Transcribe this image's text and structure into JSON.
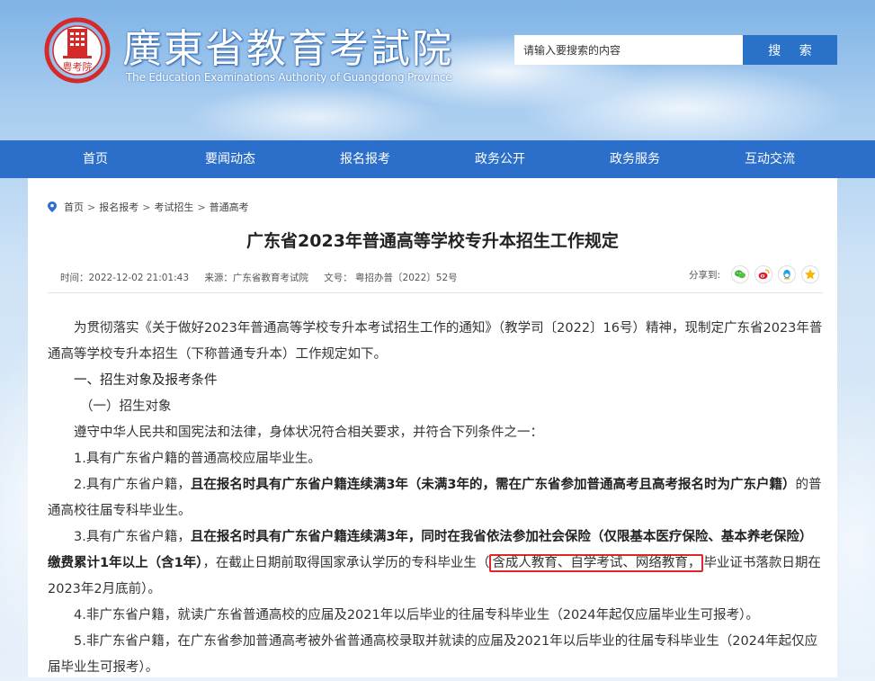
{
  "header": {
    "logo_title": "廣東省教育考試院",
    "logo_subtitle": "The Education Examinations Authority of Guangdong Province",
    "seal_text": "粤考院",
    "search_placeholder": "请输入要搜索的内容",
    "search_button": "搜 索"
  },
  "nav": {
    "items": [
      {
        "label": "首页"
      },
      {
        "label": "要闻动态"
      },
      {
        "label": "报名报考"
      },
      {
        "label": "政务公开"
      },
      {
        "label": "政务服务"
      },
      {
        "label": "互动交流"
      }
    ]
  },
  "breadcrumb": {
    "items": [
      "首页",
      "报名报考",
      "考试招生",
      "普通高考"
    ],
    "separator": ">"
  },
  "article": {
    "title": "广东省2023年普通高等学校专升本招生工作规定",
    "time": "时间：2022-12-02 21:01:43",
    "source": "来源：广东省教育考试院",
    "doc_no": "文号：  粤招办普〔2022〕52号",
    "share_label": "分享到:",
    "share_icons": [
      "wechat-icon",
      "weibo-icon",
      "qq-icon",
      "qzone-icon"
    ],
    "p1": "为贯彻落实《关于做好2023年普通高等学校专升本考试招生工作的通知》（教学司〔2022〕16号）精神，现制定广东省2023年普通高等学校专升本招生（下称普通专升本）工作规定如下。",
    "h1": "一、招生对象及报考条件",
    "h2": "（一）招生对象",
    "p2": "遵守中华人民共和国宪法和法律，身体状况符合相关要求，并符合下列条件之一：",
    "c1": "1.具有广东省户籍的普通高校应届毕业生。",
    "c2_a": "2.具有广东省户籍，",
    "c2_b": "且在报名时具有广东省户籍连续满3年（未满3年的，需在广东省参加普通高考且高考报名时为广东户籍）",
    "c2_c": "的普通高校往届专科毕业生。",
    "c3_a": "3.具有广东省户籍，",
    "c3_b": "且在报名时具有广东省户籍连续满3年，同时在我省依法参加社会保险（仅限基本医疗保险、基本养老保险）缴费累计1年以上（含1年）",
    "c3_c": "，在截止日期前取得国家承认学历的专科毕业生（",
    "c3_hl": "含成人教育、自学考试、网络教育，",
    "c3_d": "毕业证书落款日期在2023年2月底前）。",
    "c4": "4.非广东省户籍，就读广东省普通高校的应届及2021年以后毕业的往届专科毕业生（2024年起仅应届毕业生可报考）。",
    "c5": "5.非广东省户籍，在广东省参加普通高考被外省普通高校录取并就读的应届及2021年以后毕业的往届专科毕业生（2024年起仅应届毕业生可报考）。"
  },
  "colors": {
    "nav_bg": "#2b6fcb",
    "search_button_bg": "#2a72c8",
    "highlight_border": "#e0262b"
  }
}
